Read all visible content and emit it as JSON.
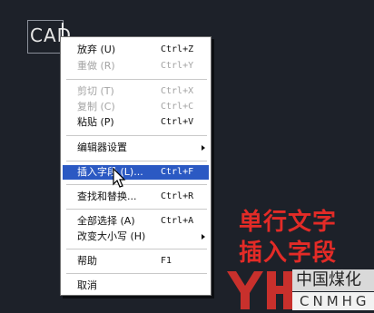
{
  "canvas_text": "CAD",
  "menu": {
    "items": [
      {
        "label": "放弃 (U)",
        "shortcut": "Ctrl+Z",
        "disabled": false
      },
      {
        "label": "重做 (R)",
        "shortcut": "Ctrl+Y",
        "disabled": true
      },
      {
        "label": "剪切 (T)",
        "shortcut": "Ctrl+X",
        "disabled": true
      },
      {
        "label": "复制 (C)",
        "shortcut": "Ctrl+C",
        "disabled": true
      },
      {
        "label": "粘贴 (P)",
        "shortcut": "Ctrl+V",
        "disabled": false
      },
      {
        "label": "编辑器设置",
        "shortcut": "",
        "submenu": true
      },
      {
        "label": "插入字段 (L)...",
        "shortcut": "Ctrl+F",
        "highlighted": true
      },
      {
        "label": "查找和替换...",
        "shortcut": "Ctrl+R"
      },
      {
        "label": "全部选择 (A)",
        "shortcut": "Ctrl+A"
      },
      {
        "label": "改变大小写 (H)",
        "shortcut": "",
        "submenu": true
      },
      {
        "label": "帮助",
        "shortcut": "F1"
      },
      {
        "label": "取消",
        "shortcut": ""
      }
    ]
  },
  "caption": {
    "line1": "单行文字",
    "line2": "插入字段",
    "color": "#e32b27"
  },
  "logo": {
    "cn_text": "中国煤化工",
    "en_text": "CNMHG"
  },
  "icons": {
    "pointer": "mouse-pointer-icon",
    "submenu": "chevron-right-icon"
  }
}
